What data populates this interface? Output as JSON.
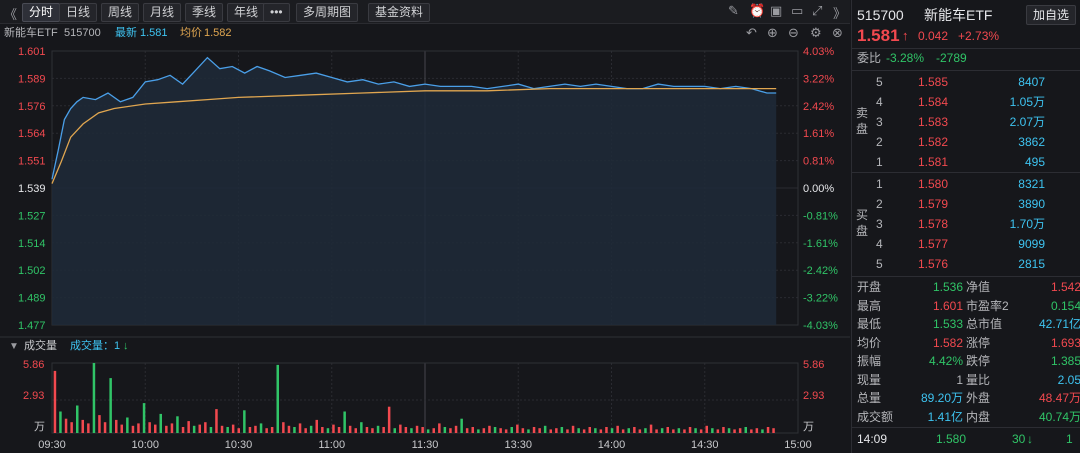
{
  "toolbar": {
    "nav": "《",
    "tabs": [
      "分时",
      "日线",
      "周线",
      "月线",
      "季线",
      "年线",
      "•••",
      "多周期图",
      "基金资料"
    ],
    "active_tab": "分时"
  },
  "info": {
    "name": "新能车ETF",
    "code": "515700",
    "latest_label": "最新",
    "latest": "1.581",
    "avg_label": "均价",
    "avg": "1.582"
  },
  "price_axis": {
    "left": [
      "1.601",
      "1.589",
      "1.576",
      "1.564",
      "1.551",
      "1.539",
      "1.527",
      "1.514",
      "1.502",
      "1.489",
      "1.477"
    ],
    "right": [
      "4.03%",
      "3.22%",
      "2.42%",
      "1.61%",
      "0.81%",
      "0.00%",
      "-0.81%",
      "-1.61%",
      "-2.42%",
      "-3.22%",
      "-4.03%"
    ]
  },
  "volume": {
    "title": "成交量",
    "indicator_label": "成交量：",
    "indicator_value": "1",
    "indicator_arrow": "↓",
    "ticks": [
      "5.86",
      "2.93",
      "万"
    ]
  },
  "time_axis": [
    "09:30",
    "10:00",
    "10:30",
    "11:00",
    "11:30",
    "13:30",
    "14:00",
    "14:30",
    "15:00"
  ],
  "chart_data": {
    "type": "line",
    "x_unit": "minutes since 09:30 (trading session)",
    "ylim": [
      1.477,
      1.601
    ],
    "prev_close": 1.539,
    "series": [
      {
        "x": [
          0,
          2,
          4,
          6,
          8,
          10,
          14,
          18,
          22,
          26,
          30,
          34,
          38,
          42,
          46,
          50,
          54,
          58,
          62,
          66,
          70,
          75,
          80,
          85,
          90,
          95,
          100,
          105,
          110,
          115,
          120,
          125,
          130,
          135,
          140,
          145,
          150,
          155,
          160,
          165,
          170,
          175,
          180,
          185,
          190,
          195,
          200,
          205,
          210,
          215,
          220,
          225,
          230,
          233
        ],
        "values": [
          1.543,
          1.556,
          1.57,
          1.575,
          1.578,
          1.58,
          1.579,
          1.582,
          1.578,
          1.58,
          1.587,
          1.588,
          1.59,
          1.586,
          1.592,
          1.598,
          1.593,
          1.594,
          1.591,
          1.594,
          1.592,
          1.589,
          1.59,
          1.591,
          1.589,
          1.587,
          1.588,
          1.586,
          1.587,
          1.585,
          1.586,
          1.585,
          1.585,
          1.585,
          1.584,
          1.585,
          1.586,
          1.584,
          1.585,
          1.586,
          1.585,
          1.586,
          1.585,
          1.584,
          1.584,
          1.586,
          1.585,
          1.585,
          1.585,
          1.584,
          1.585,
          1.584,
          1.582,
          1.582
        ]
      },
      {
        "x": [
          0,
          3,
          6,
          10,
          15,
          20,
          30,
          40,
          50,
          60,
          80,
          100,
          120,
          140,
          160,
          180,
          200,
          220,
          233
        ],
        "values": [
          1.541,
          1.551,
          1.562,
          1.568,
          1.573,
          1.575,
          1.577,
          1.578,
          1.579,
          1.58,
          1.581,
          1.582,
          1.583,
          1.583,
          1.584,
          1.584,
          1.584,
          1.584,
          1.584
        ]
      }
    ],
    "volume": {
      "ylim": [
        0,
        5.86
      ],
      "unit": "万",
      "values": [
        5.2,
        1.8,
        1.2,
        0.9,
        2.3,
        1.1,
        0.8,
        5.86,
        1.5,
        0.9,
        4.6,
        1.1,
        0.7,
        1.3,
        0.6,
        0.8,
        2.5,
        0.9,
        0.7,
        1.6,
        0.6,
        0.8,
        1.4,
        0.5,
        1.0,
        0.6,
        0.7,
        0.9,
        0.5,
        2.0,
        0.6,
        0.5,
        0.7,
        0.4,
        1.9,
        0.5,
        0.6,
        0.8,
        0.4,
        0.5,
        5.7,
        0.9,
        0.6,
        0.5,
        0.8,
        0.4,
        0.6,
        1.1,
        0.5,
        0.4,
        0.7,
        0.5,
        1.8,
        0.6,
        0.4,
        0.9,
        0.5,
        0.4,
        0.6,
        0.5,
        2.2,
        0.4,
        0.7,
        0.5,
        0.4,
        0.6,
        0.5,
        0.3,
        0.4,
        0.8,
        0.5,
        0.4,
        0.6,
        1.2,
        0.4,
        0.5,
        0.3,
        0.4,
        0.6,
        0.5,
        0.4,
        0.3,
        0.5,
        0.7,
        0.4,
        0.3,
        0.5,
        0.4,
        0.6,
        0.3,
        0.4,
        0.5,
        0.3,
        0.6,
        0.4,
        0.3,
        0.5,
        0.4,
        0.3,
        0.5,
        0.4,
        0.6,
        0.3,
        0.4,
        0.5,
        0.3,
        0.4,
        0.7,
        0.3,
        0.4,
        0.5,
        0.3,
        0.4,
        0.3,
        0.5,
        0.4,
        0.3,
        0.6,
        0.4,
        0.3,
        0.5,
        0.4,
        0.3,
        0.4,
        0.5,
        0.3,
        0.4,
        0.3,
        0.5,
        0.4
      ]
    }
  },
  "quote": {
    "code": "515700",
    "name": "新能车ETF",
    "add_btn": "加自选",
    "price": "1.581",
    "arrow": "↑",
    "change": "0.042",
    "change_pct": "+2.73%",
    "weibi_label": "委比",
    "weibi_pct": "-3.28%",
    "weibi_val": "-2789"
  },
  "order_book": {
    "sell_label": [
      "卖",
      "盘"
    ],
    "buy_label": [
      "买",
      "盘"
    ],
    "sell": [
      {
        "level": "5",
        "price": "1.585",
        "vol": "8407"
      },
      {
        "level": "4",
        "price": "1.584",
        "vol": "1.05万"
      },
      {
        "level": "3",
        "price": "1.583",
        "vol": "2.07万"
      },
      {
        "level": "2",
        "price": "1.582",
        "vol": "3862"
      },
      {
        "level": "1",
        "price": "1.581",
        "vol": "495"
      }
    ],
    "buy": [
      {
        "level": "1",
        "price": "1.580",
        "vol": "8321"
      },
      {
        "level": "2",
        "price": "1.579",
        "vol": "3890"
      },
      {
        "level": "3",
        "price": "1.578",
        "vol": "1.70万"
      },
      {
        "level": "4",
        "price": "1.577",
        "vol": "9099"
      },
      {
        "level": "5",
        "price": "1.576",
        "vol": "2815"
      }
    ]
  },
  "stats": [
    {
      "l1": "开盘",
      "v1": "1.536",
      "c1": "green",
      "l2": "净值",
      "v2": "1.542",
      "c2": "red"
    },
    {
      "l1": "最高",
      "v1": "1.601",
      "c1": "red",
      "l2": "市盈率2",
      "v2": "0.154",
      "c2": "green"
    },
    {
      "l1": "最低",
      "v1": "1.533",
      "c1": "green",
      "l2": "总市值",
      "v2": "42.71亿",
      "c2": "blue"
    },
    {
      "l1": "均价",
      "v1": "1.582",
      "c1": "red",
      "l2": "涨停",
      "v2": "1.693",
      "c2": "red"
    },
    {
      "l1": "振幅",
      "v1": "4.42%",
      "c1": "green",
      "l2": "跌停",
      "v2": "1.385",
      "c2": "green"
    },
    {
      "l1": "现量",
      "v1": "1",
      "c1": "grey",
      "l2": "量比",
      "v2": "2.05",
      "c2": "blue"
    },
    {
      "l1": "总量",
      "v1": "89.20万",
      "c1": "blue",
      "l2": "外盘",
      "v2": "48.47万",
      "c2": "red"
    },
    {
      "l1": "成交额",
      "v1": "1.41亿",
      "c1": "blue",
      "l2": "内盘",
      "v2": "40.74万",
      "c2": "green"
    }
  ],
  "tick": {
    "time": "14:09",
    "price": "1.580",
    "vol": "30",
    "arrow": "↓",
    "count": "1"
  },
  "colors": {
    "up": "#f2494f",
    "down": "#30c467",
    "price_line": "#4a9fe8",
    "avg_line": "#e0a650",
    "grid": "#2a2b31"
  }
}
